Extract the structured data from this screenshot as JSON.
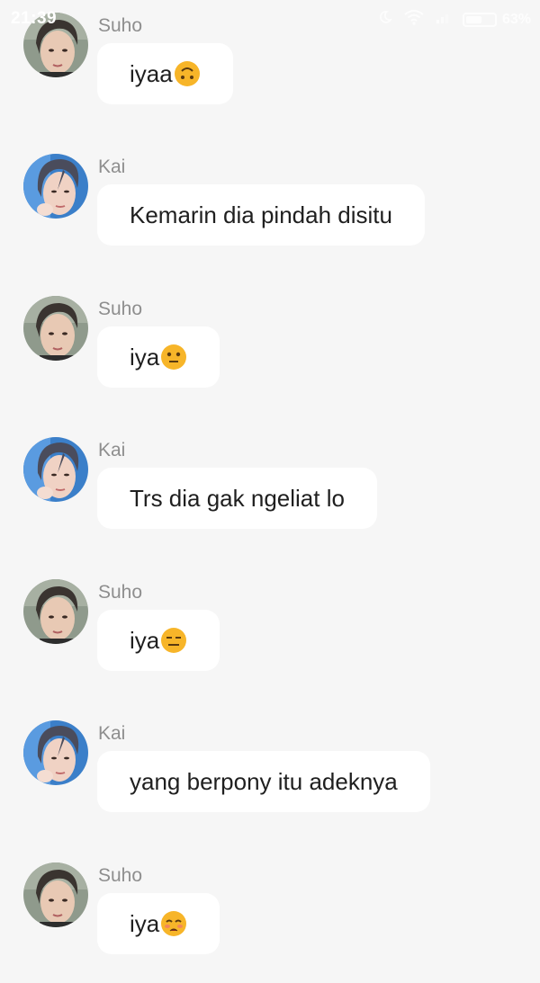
{
  "status_bar": {
    "time": "21:39",
    "battery_percent": "63%",
    "battery_level": 0.63,
    "icons": [
      "moon-icon",
      "wifi-icon",
      "signal-icon",
      "battery-icon"
    ]
  },
  "colors": {
    "background": "#f6f6f6",
    "bubble": "#ffffff",
    "sender_name": "#8e8e8e",
    "message_text": "#1f1f1f",
    "emoji_face": "#f7b529"
  },
  "messages": [
    {
      "sender": "Suho",
      "text": "iyaa",
      "emoji": "upside-down-face-emoji"
    },
    {
      "sender": "Kai",
      "text": "Kemarin dia pindah disitu",
      "emoji": ""
    },
    {
      "sender": "Suho",
      "text": "iya",
      "emoji": "neutral-face-emoji"
    },
    {
      "sender": "Kai",
      "text": "Trs dia gak ngeliat lo",
      "emoji": ""
    },
    {
      "sender": "Suho",
      "text": "iya",
      "emoji": "expressionless-face-emoji"
    },
    {
      "sender": "Kai",
      "text": "yang berpony itu adeknya",
      "emoji": ""
    },
    {
      "sender": "Suho",
      "text": "iya",
      "emoji": "flushed-sad-face-emoji"
    }
  ]
}
